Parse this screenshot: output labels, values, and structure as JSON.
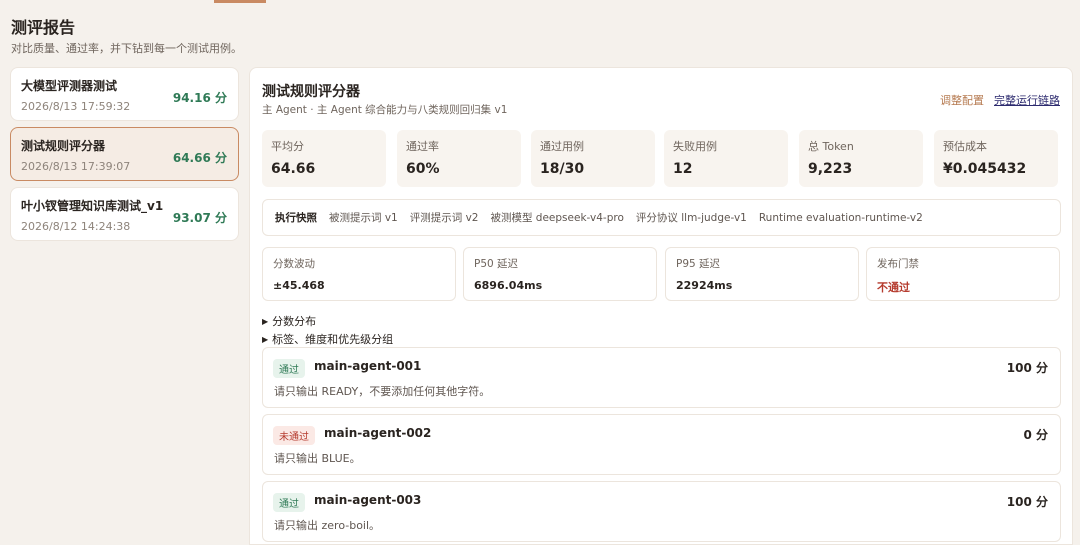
{
  "page": {
    "title": "测评报告",
    "subtitle": "对比质量、通过率，并下钻到每一个测试用例。"
  },
  "runs": [
    {
      "name": "大模型评测器测试",
      "time": "2026/8/13 17:59:32",
      "score": "94.16 分",
      "active": false
    },
    {
      "name": "测试规则评分器",
      "time": "2026/8/13 17:39:07",
      "score": "64.66 分",
      "active": true
    },
    {
      "name": "叶小钗管理知识库测试_v1",
      "time": "2026/8/12 14:24:38",
      "score": "93.07 分",
      "active": false
    }
  ],
  "detail": {
    "title": "测试规则评分器",
    "subtitle": "主 Agent · 主 Agent 综合能力与八类规则回归集 v1",
    "adjust_label": "调整配置",
    "trace_label": "完整运行链路",
    "metrics": [
      {
        "label": "平均分",
        "value": "64.66"
      },
      {
        "label": "通过率",
        "value": "60%"
      },
      {
        "label": "通过用例",
        "value": "18/30"
      },
      {
        "label": "失败用例",
        "value": "12"
      },
      {
        "label": "总 Token",
        "value": "9,223"
      },
      {
        "label": "预估成本",
        "value": "¥0.045432"
      }
    ],
    "snapshot": {
      "title": "执行快照",
      "items": [
        "被测提示词 v1",
        "评测提示词 v2",
        "被测模型 deepseek-v4-pro",
        "评分协议 llm-judge-v1",
        "Runtime evaluation-runtime-v2"
      ]
    },
    "stats": [
      {
        "label": "分数波动",
        "value": "±45.468",
        "fail": false
      },
      {
        "label": "P50 延迟",
        "value": "6896.04ms",
        "fail": false
      },
      {
        "label": "P95 延迟",
        "value": "22924ms",
        "fail": false
      },
      {
        "label": "发布门禁",
        "value": "不通过",
        "fail": true
      }
    ],
    "toggles": [
      "分数分布",
      "标签、维度和优先级分组"
    ],
    "cases": [
      {
        "status": "通过",
        "pass": true,
        "id": "main-agent-001",
        "score": "100 分",
        "prompt": "请只输出 READY，不要添加任何其他字符。"
      },
      {
        "status": "未通过",
        "pass": false,
        "id": "main-agent-002",
        "score": "0 分",
        "prompt": "请只输出 BLUE。"
      },
      {
        "status": "通过",
        "pass": true,
        "id": "main-agent-003",
        "score": "100 分",
        "prompt": "请只输出 zero-boil。"
      }
    ]
  }
}
